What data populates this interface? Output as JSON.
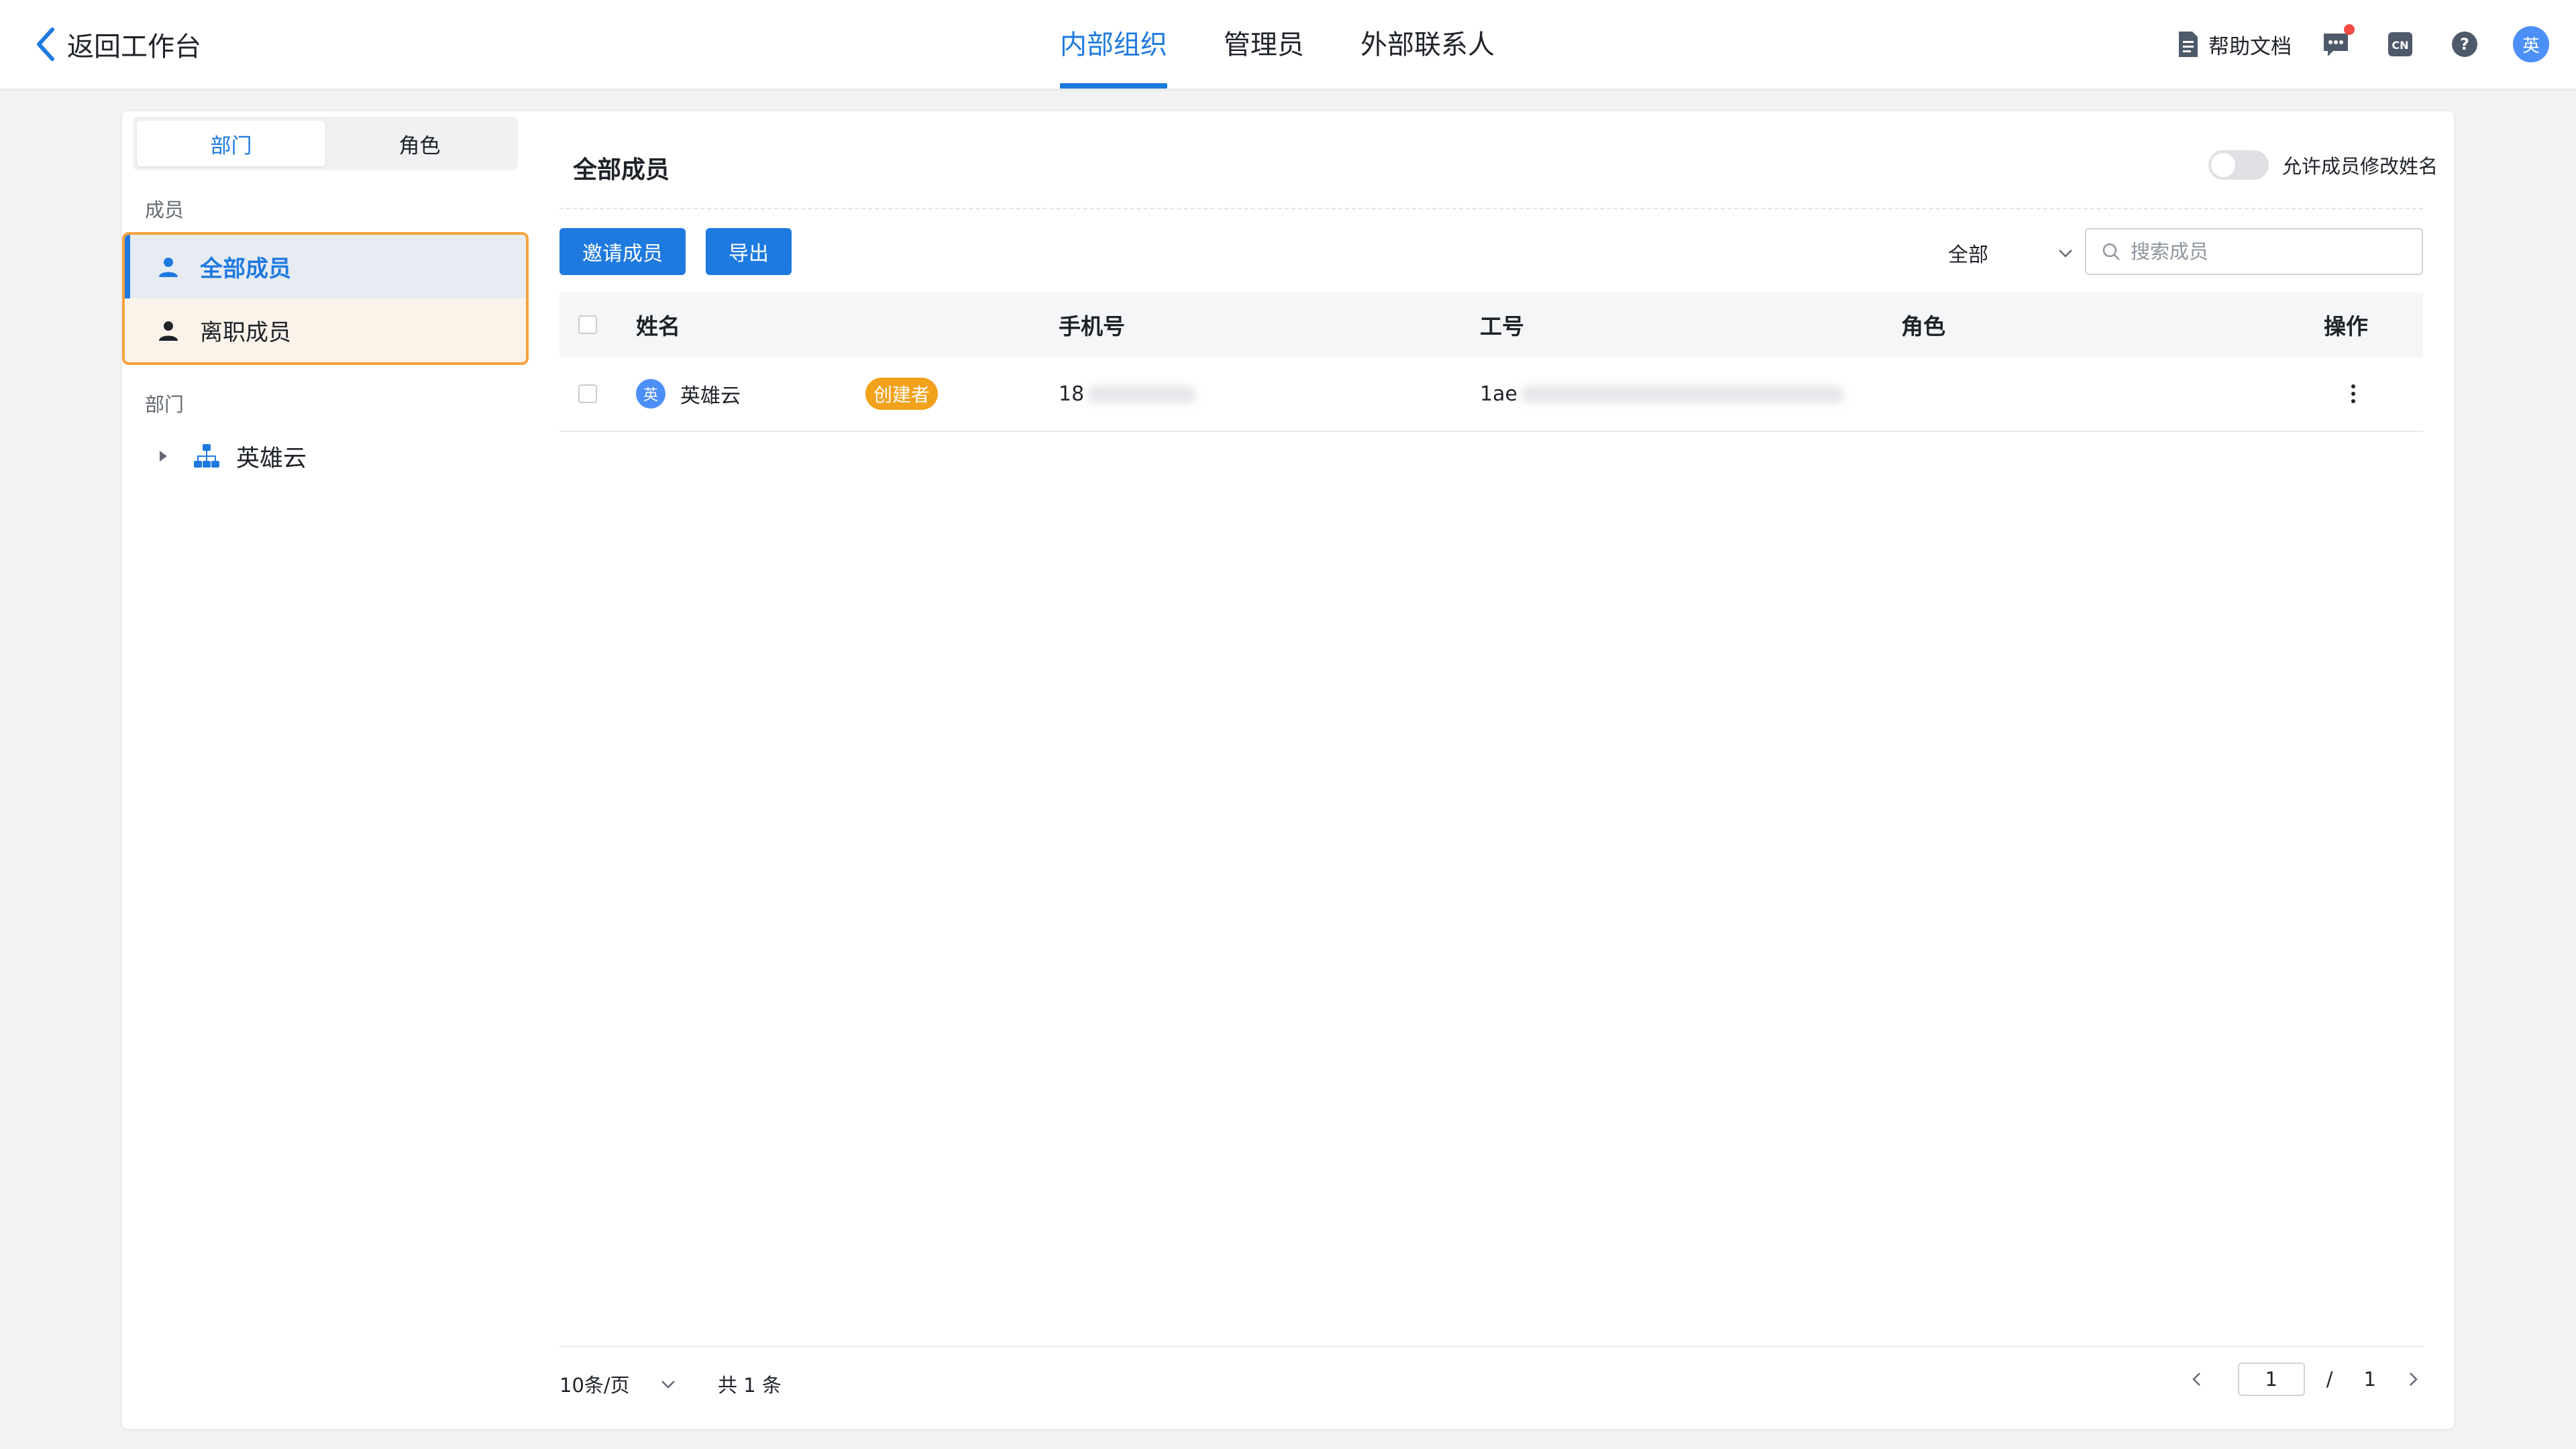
{
  "topbar": {
    "back_label": "返回工作台",
    "tabs": [
      {
        "label": "内部组织",
        "active": true
      },
      {
        "label": "管理员",
        "active": false
      },
      {
        "label": "外部联系人",
        "active": false
      }
    ],
    "help_doc": "帮助文档",
    "lang_badge": "CN",
    "help_icon_text": "?",
    "avatar_text": "英"
  },
  "sidebar": {
    "segments": [
      {
        "label": "部门",
        "active": true
      },
      {
        "label": "角色",
        "active": false
      }
    ],
    "members_label": "成员",
    "member_items": [
      {
        "label": "全部成员",
        "active": true
      },
      {
        "label": "离职成员",
        "active": false
      }
    ],
    "departments_label": "部门",
    "departments": [
      {
        "label": "英雄云"
      }
    ]
  },
  "main": {
    "title": "全部成员",
    "toggle_label": "允许成员修改姓名",
    "toggle_on": false,
    "invite_button": "邀请成员",
    "export_button": "导出",
    "filter_value": "全部",
    "search_placeholder": "搜索成员",
    "columns": [
      "姓名",
      "手机号",
      "工号",
      "角色",
      "操作"
    ],
    "rows": [
      {
        "avatar": "英",
        "name": "英雄云",
        "badge": "创建者",
        "phone_visible": "18",
        "employee_id_visible": "1ae",
        "role": ""
      }
    ],
    "pagination": {
      "page_size": "10条/页",
      "total": "共 1 条",
      "current_page": "1",
      "separator": "/",
      "total_pages": "1"
    }
  },
  "colors": {
    "accent": "#1f7ae0",
    "badge": "#f2a11a",
    "highlight_border": "#f5a23c",
    "notification_dot": "#f54a45"
  }
}
